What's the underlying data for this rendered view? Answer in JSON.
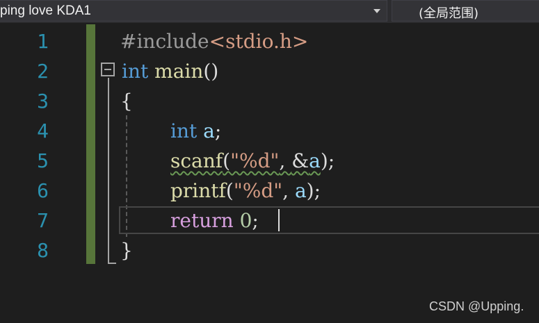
{
  "navbar": {
    "scope_text": "ping love KDA1",
    "member_text": "(全局范围)"
  },
  "editor": {
    "line_numbers": [
      "1",
      "2",
      "3",
      "4",
      "5",
      "6",
      "7",
      "8"
    ],
    "code": {
      "l1": {
        "directive": "#include",
        "header": "<stdio.h>"
      },
      "l2": {
        "type": "int",
        "name": "main",
        "parens": "()"
      },
      "l3": {
        "brace": "{"
      },
      "l4": {
        "type": "int",
        "var": "a",
        "semi": ";"
      },
      "l5": {
        "fn": "scanf",
        "open": "(",
        "str": "\"%d\"",
        "comma": ", ",
        "amp": "&",
        "var": "a",
        "close": ");"
      },
      "l6": {
        "fn": "printf",
        "open": "(",
        "str": "\"%d\"",
        "comma": ", ",
        "var": "a",
        "close": ");"
      },
      "l7": {
        "keyword": "return",
        "num": "0",
        "semi": ";"
      },
      "l8": {
        "brace": "}"
      }
    },
    "colors": {
      "background": "#1e1e1e",
      "line_number": "#2b91af",
      "keyword": "#569cd6",
      "control_keyword": "#d8a0df",
      "function": "#dcdcaa",
      "string": "#d69d85",
      "variable": "#9cdcfe",
      "number": "#b5cea8",
      "change_bar": "#57753a"
    }
  },
  "watermark": "CSDN @Upping."
}
